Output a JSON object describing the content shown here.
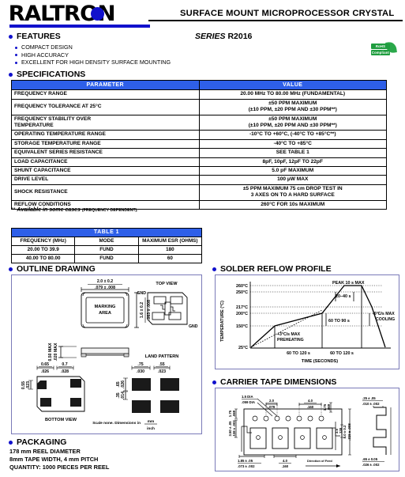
{
  "header": {
    "logo_text": "RALTRON",
    "title": "SURFACE MOUNT MICROPROCESSOR CRYSTAL",
    "series_label": "SERIES",
    "series_value": "R2016",
    "rohs_line1": "RoHS",
    "rohs_line2": "Compliant"
  },
  "features": {
    "heading": "FEATURES",
    "items": [
      "COMPACT DESIGN",
      "HIGH ACCURACY",
      "EXCELLENT FOR HIGH DENSITY SURFACE MOUNTING"
    ]
  },
  "specifications": {
    "heading": "SPECIFICATIONS",
    "columns": [
      "PARAMETER",
      "VALUE"
    ],
    "rows": [
      {
        "parameter": "FREQUENCY RANGE",
        "value": "20.00 MHz TO 80.00 MHz (FUNDAMENTAL)"
      },
      {
        "parameter": "FREQUENCY TOLERANCE AT 25°C",
        "value": "±50 PPM MAXIMUM\n(±10 PPM, ±20 PPM AND ±30 PPM**)"
      },
      {
        "parameter": "FREQUENCY STABILITY OVER\nTEMPERATURE",
        "value": "±50 PPM MAXIMUM\n(±10 PPM, ±20 PPM AND ±30 PPM**)"
      },
      {
        "parameter": "OPERATING TEMPERATURE RANGE",
        "value": "-10°C TO +60°C, (-40°C TO +85°C**)"
      },
      {
        "parameter": "STORAGE TEMPERATURE RANGE",
        "value": "-40°C TO +85°C"
      },
      {
        "parameter": "EQUIVALENT SERIES RESISTANCE",
        "value": "SEE TABLE 1"
      },
      {
        "parameter": "LOAD CAPACITANCE",
        "value": "8pF, 10pF, 12pF TO 22pF"
      },
      {
        "parameter": "SHUNT CAPACITANCE",
        "value": "5.0 pF MAXIMUM"
      },
      {
        "parameter": "DRIVE LEVEL",
        "value": "100 µW MAX"
      },
      {
        "parameter": "SHOCK RESISTANCE",
        "value": "±5 PPM MAXIMUM 75 cm DROP TEST IN\n3 AXES ON TO A HARD SURFACE"
      },
      {
        "parameter": "REFLOW CONDITIONS",
        "value": "260°C FOR 10s MAXIMUM"
      }
    ],
    "footnote_prefix": "**",
    "footnote_italic": "Available in some cases",
    "footnote_small": "(FREQUENCY DEPENDENT)."
  },
  "table1": {
    "title": "TABLE 1",
    "columns": [
      "FREQUENCY (MHz)",
      "MODE",
      "MAXIMUM ESR (OHMS)"
    ],
    "rows": [
      [
        "20.00 TO 39.9",
        "FUND",
        "180"
      ],
      [
        "40.00 TO 80.00",
        "FUND",
        "60"
      ]
    ]
  },
  "outline": {
    "heading": "OUTLINE DRAWING",
    "labels": {
      "width_mm": "2.0 ± 0.2",
      "width_in": ".079 ± .008",
      "height_mm": "1.6 ± 0.2",
      "height_in": ".063 ± .008",
      "thickness_mm": "0.50 MAX",
      "thickness_in": ".020 MAX",
      "marking_area": "MARKING\nAREA",
      "top_view": "TOP VIEW",
      "gnd": "GND",
      "land_pattern": "LAND PATTERN",
      "bottom_view": "BOTTOM VIEW",
      "pad_a_mm": "0.65",
      "pad_a_in": ".026",
      "pad_b_mm": "0.7",
      "pad_b_in": ".028",
      "pad_c_mm": "0.55",
      "pad_c_in": ".023",
      "land_a_mm": ".75",
      "land_a_in": ".030",
      "land_b_mm": ".55",
      "land_b_in": ".023",
      "land_c_mm": ".65",
      "land_c_in": ".026",
      "land_d_mm": ".35",
      "land_d_in": ".014",
      "scale_note": "Scale none. Dimensions in",
      "scale_num": "mm",
      "scale_den": "inch"
    }
  },
  "reflow": {
    "heading": "SOLDER REFLOW PROFILE",
    "annotations": {
      "peak": "PEAK 10 s MAX",
      "soak": "20–40 s",
      "above217": "60 TO 90 s",
      "cooling": "-6°C/s MAX\nCOOLING",
      "preheat": "+3°C/s MAX\nPREHEATING",
      "seg1": "60 TO 120 s",
      "seg2": "60 TO 120 s"
    }
  },
  "carrier": {
    "heading": "CARRIER TAPE DIMENSIONS",
    "labels": {
      "hole_dia_mm": "1.5 DIA",
      "hole_dia_in": ".059 DIA",
      "pitch_mm": "2.0",
      "pitch_in": ".079",
      "span_mm": "4.0",
      "span_in": ".160",
      "edge_mm": "1.75",
      "edge_in": ".069",
      "tape_thk_mm": ".25 ± .05",
      "tape_thk_in": ".010 ± .002",
      "pocket_mm": "3.5",
      "pocket_in": ".138",
      "width_mm": "8.0 ± 0.2",
      "width_in": ".315 ± .008",
      "left_mm": "3.50 ± .05",
      "left_in": ".138 ± .002",
      "bot_a_mm": "1.85 ± .05",
      "bot_a_in": ".073 ± .002",
      "bot_b_mm": "4.0",
      "bot_b_in": ".160",
      "bot_c_mm": ".65 ± 0.05",
      "bot_c_in": ".026 ± .002",
      "direction": "Direction of Feed"
    }
  },
  "packaging": {
    "heading": "PACKAGING",
    "lines": [
      "178 mm REEL DIAMETER",
      "8mm TAPE WIDTH, 4 mm PITCH",
      "QUANTITY: 1000 PIECES PER REEL"
    ]
  },
  "chart_data": {
    "type": "line",
    "title": "SOLDER REFLOW PROFILE",
    "xlabel": "TIME (SECONDS)",
    "ylabel": "TEMPERATURE (°C)",
    "ytick_labels": [
      "260°C",
      "250°C",
      "217°C",
      "200°C",
      "150°C",
      "25°C"
    ],
    "ytick_values": [
      260,
      250,
      217,
      200,
      150,
      25
    ],
    "ylim": [
      25,
      270
    ],
    "xlim": [
      0,
      400
    ],
    "grid": "horizontal-dotted",
    "series": [
      {
        "name": "Reflow profile",
        "x": [
          0,
          70,
          190,
          235,
          275,
          300,
          370
        ],
        "y": [
          25,
          150,
          200,
          260,
          260,
          217,
          25
        ]
      },
      {
        "name": "Preheat ramp (+3°C/s max)",
        "style": "dotted",
        "x": [
          0,
          190
        ],
        "y": [
          25,
          217
        ]
      }
    ],
    "annotations": [
      "PEAK 10 s MAX",
      "20–40 s",
      "60 TO 90 s",
      "-6°C/s MAX COOLING",
      "+3°C/s MAX PREHEATING",
      "60 TO 120 s",
      "60 TO 120 s"
    ]
  }
}
